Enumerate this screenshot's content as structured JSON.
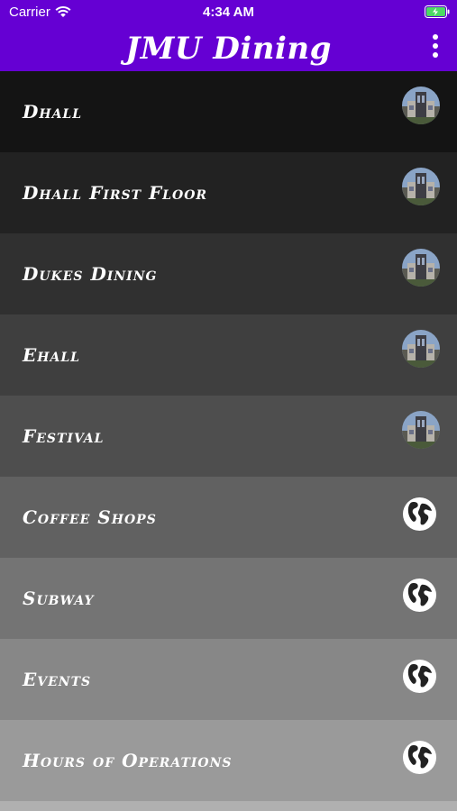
{
  "status_bar": {
    "carrier": "Carrier",
    "time": "4:34 AM"
  },
  "header": {
    "title": "JMU Dining",
    "menu_icon": "more-vertical-icon"
  },
  "colors": {
    "header": "#6500d3"
  },
  "rows": [
    {
      "label": "Dhall",
      "icon": "building-photo",
      "bg": "#141414"
    },
    {
      "label": "Dhall First Floor",
      "icon": "building-photo",
      "bg": "#222222"
    },
    {
      "label": "Dukes Dining",
      "icon": "building-photo",
      "bg": "#303030"
    },
    {
      "label": "Ehall",
      "icon": "building-photo",
      "bg": "#3f3f3f"
    },
    {
      "label": "Festival",
      "icon": "building-photo",
      "bg": "#4e4e4e"
    },
    {
      "label": "Coffee Shops",
      "icon": "globe-icon",
      "bg": "#616161"
    },
    {
      "label": "Subway",
      "icon": "globe-icon",
      "bg": "#747474"
    },
    {
      "label": "Events",
      "icon": "globe-icon",
      "bg": "#878787"
    },
    {
      "label": "Hours of Operations",
      "icon": "globe-icon",
      "bg": "#9a9a9a"
    }
  ]
}
